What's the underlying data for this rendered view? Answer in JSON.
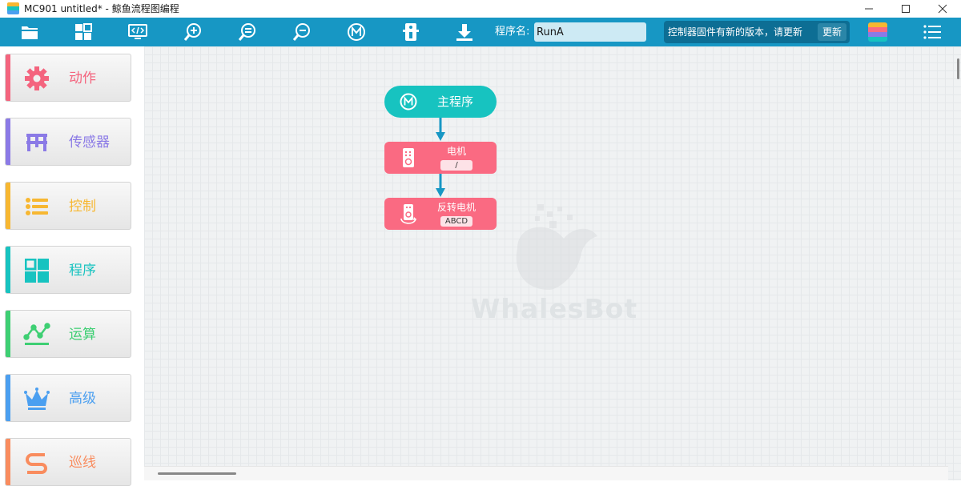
{
  "window": {
    "title": "MC901 untitled* - 鲸鱼流程图编程"
  },
  "toolbar": {
    "icons": [
      "open-folder-icon",
      "blocks-grid-icon",
      "monitor-code-icon",
      "zoom-in-icon",
      "zoom-reset-icon",
      "zoom-out-icon",
      "main-program-icon",
      "controller-icon",
      "download-icon"
    ],
    "program_label": "程序名:",
    "program_name": "RunA",
    "firmware_notice": "控制器固件有新的版本，请更新",
    "update_label": "更新"
  },
  "sidebar": {
    "items": [
      {
        "label": "动作",
        "color": "#f4647e",
        "icon": "gear-icon"
      },
      {
        "label": "传感器",
        "color": "#8b7ae6",
        "icon": "sensor-icon"
      },
      {
        "label": "控制",
        "color": "#f7b731",
        "icon": "list-icon"
      },
      {
        "label": "程序",
        "color": "#17c3c0",
        "icon": "program-grid-icon"
      },
      {
        "label": "运算",
        "color": "#3ecf73",
        "icon": "operation-icon"
      },
      {
        "label": "高级",
        "color": "#4b9ff0",
        "icon": "crown-icon"
      },
      {
        "label": "巡线",
        "color": "#f98c5e",
        "icon": "line-follow-icon"
      }
    ]
  },
  "canvas": {
    "watermark": "WhalesBot",
    "main_block": {
      "label": "主程序",
      "color": "#17c3c0"
    },
    "blocks": [
      {
        "title": "电机",
        "param": "/",
        "color": "#fa6a82"
      },
      {
        "title": "反转电机",
        "param": "ABCD",
        "color": "#fa6a82"
      }
    ]
  }
}
